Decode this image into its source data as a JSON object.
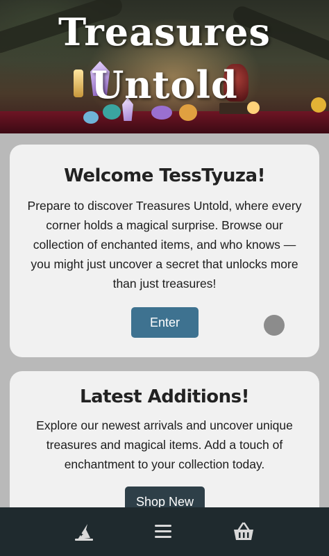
{
  "hero": {
    "title_line1": "Treasures",
    "title_line2": "Untold"
  },
  "welcome": {
    "heading": "Welcome TessTyuza!",
    "text": "Prepare to discover Treasures Untold, where every corner holds a magical surprise. Browse our collection of enchanted items, and who knows — you might just uncover a secret that unlocks more than just treasures!",
    "button_label": "Enter"
  },
  "latest": {
    "heading": "Latest Additions!",
    "text": "Explore our newest arrivals and uncover unique treasures and magical items. Add a touch of enchantment to your collection today.",
    "button_label": "Shop New"
  },
  "navbar": {
    "items": [
      {
        "icon": "wizard-hat-icon"
      },
      {
        "icon": "menu-icon"
      },
      {
        "icon": "basket-icon"
      }
    ]
  },
  "colors": {
    "primary_button": "#3e7290",
    "navbar_bg": "#1f2a2e",
    "card_bg": "#f1f1f1"
  }
}
